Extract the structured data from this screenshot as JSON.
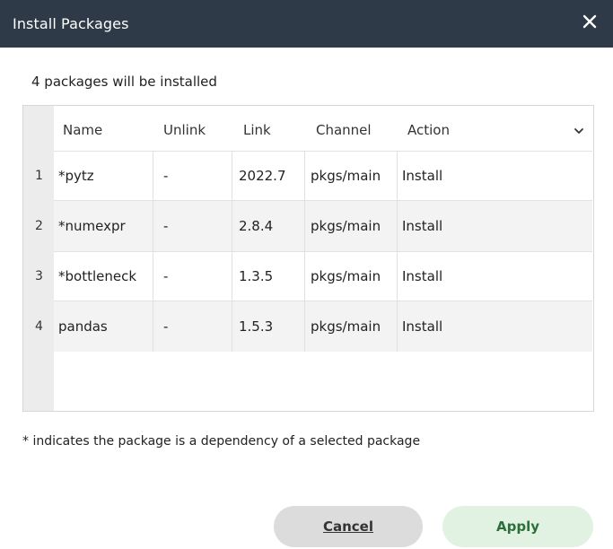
{
  "dialog": {
    "title": "Install Packages",
    "close_icon": "close-icon",
    "summary": "4 packages will be installed",
    "footnote": "* indicates the package is a dependency of a selected package"
  },
  "table": {
    "columns": [
      "Name",
      "Unlink",
      "Link",
      "Channel",
      "Action"
    ],
    "rows": [
      {
        "num": "1",
        "name": "*pytz",
        "unlink": "-",
        "link": "2022.7",
        "channel": "pkgs/main",
        "action": "Install"
      },
      {
        "num": "2",
        "name": "*numexpr",
        "unlink": "-",
        "link": "2.8.4",
        "channel": "pkgs/main",
        "action": "Install"
      },
      {
        "num": "3",
        "name": "*bottleneck",
        "unlink": "-",
        "link": "1.3.5",
        "channel": "pkgs/main",
        "action": "Install"
      },
      {
        "num": "4",
        "name": "pandas",
        "unlink": "-",
        "link": "1.5.3",
        "channel": "pkgs/main",
        "action": "Install"
      }
    ]
  },
  "buttons": {
    "cancel": "Cancel",
    "apply": "Apply"
  },
  "colors": {
    "titlebar": "#2f3a48",
    "apply_bg": "#e2f2e2",
    "apply_text": "#2d6f3a",
    "cancel_bg": "#dcdcdc"
  }
}
